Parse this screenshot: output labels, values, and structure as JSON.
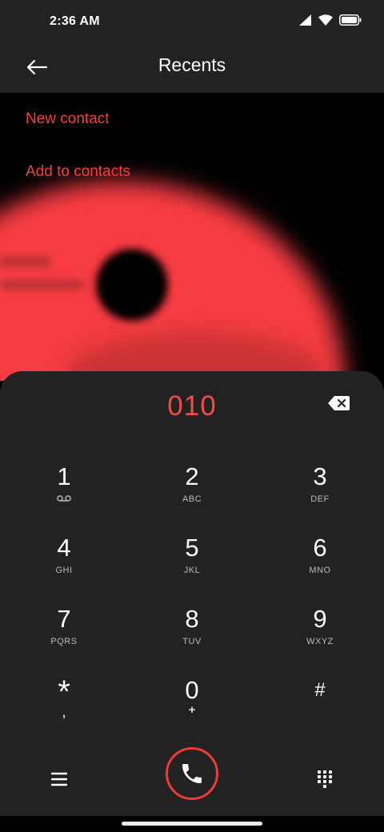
{
  "status": {
    "time": "2:36 AM"
  },
  "appbar": {
    "title": "Recents"
  },
  "menu": {
    "new_contact": "New contact",
    "add_to_contacts": "Add to contacts"
  },
  "dialer": {
    "number": "010",
    "keys": [
      {
        "digit": "1",
        "letters": ""
      },
      {
        "digit": "2",
        "letters": "ABC"
      },
      {
        "digit": "3",
        "letters": "DEF"
      },
      {
        "digit": "4",
        "letters": "GHI"
      },
      {
        "digit": "5",
        "letters": "JKL"
      },
      {
        "digit": "6",
        "letters": "MNO"
      },
      {
        "digit": "7",
        "letters": "PQRS"
      },
      {
        "digit": "8",
        "letters": "TUV"
      },
      {
        "digit": "9",
        "letters": "WXYZ"
      },
      {
        "digit": "*",
        "letters": ","
      },
      {
        "digit": "0",
        "letters": "+"
      },
      {
        "digit": "#",
        "letters": ""
      }
    ]
  },
  "colors": {
    "accent": "#f43f3f",
    "dialer_bg": "#222222",
    "content_bg": "#000000"
  },
  "icons": [
    "back-arrow-icon",
    "signal-icon",
    "wifi-icon",
    "battery-icon",
    "backspace-icon",
    "voicemail-icon",
    "menu-icon",
    "phone-icon",
    "keypad-icon"
  ]
}
